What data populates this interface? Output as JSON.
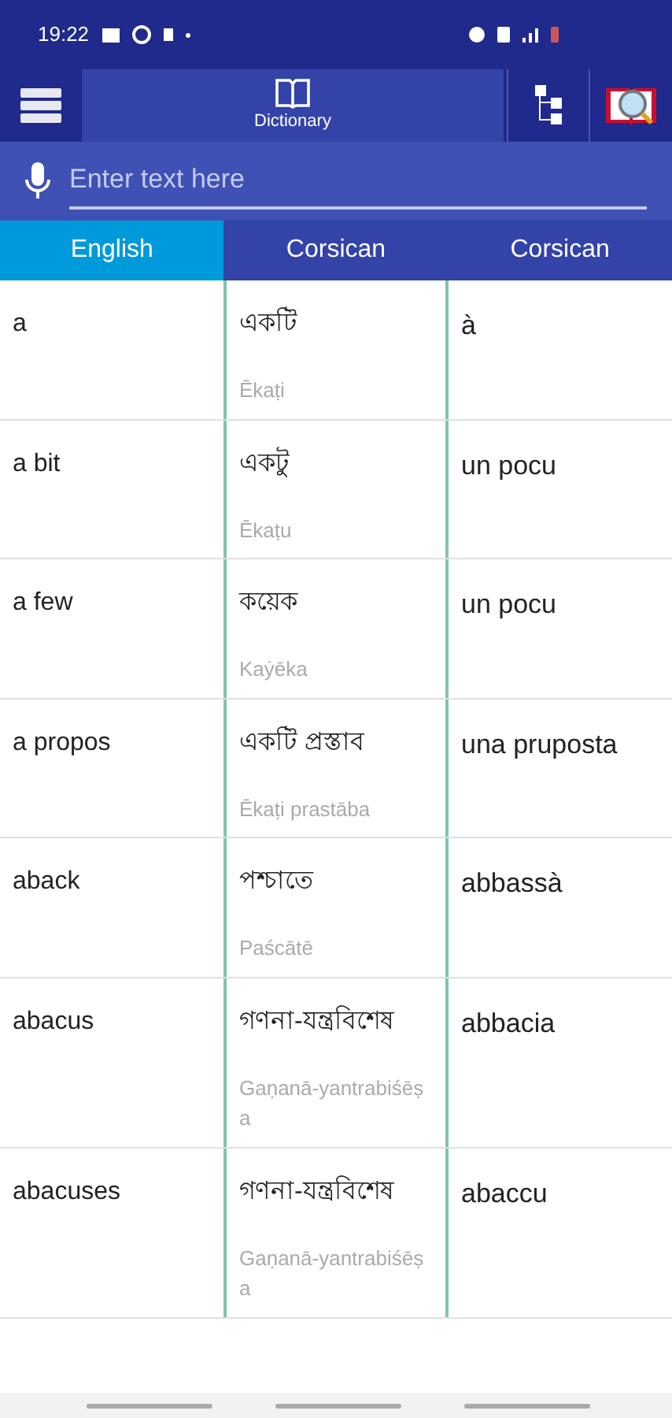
{
  "status_bar": {
    "time": "19:22"
  },
  "toolbar": {
    "title": "Dictionary"
  },
  "search": {
    "placeholder": "Enter text here"
  },
  "tabs": [
    {
      "label": "English",
      "selected": true
    },
    {
      "label": "Corsican",
      "selected": false
    },
    {
      "label": "Corsican",
      "selected": false
    }
  ],
  "rows": [
    {
      "english": "a",
      "bengali": "একটি",
      "transliteration": "Ēkaṭi",
      "corsican": "à"
    },
    {
      "english": "a bit",
      "bengali": "একটু",
      "transliteration": "Ēkaṭu",
      "corsican": "un pocu"
    },
    {
      "english": "a few",
      "bengali": "কয়েক",
      "transliteration": "Kaẏēka",
      "corsican": "un pocu"
    },
    {
      "english": "a propos",
      "bengali": "একটি প্রস্তাব",
      "transliteration": "Ēkaṭi prastāba",
      "corsican": "una pruposta"
    },
    {
      "english": "aback",
      "bengali": "পশ্চাতে",
      "transliteration": "Paścātē",
      "corsican": "abbassà"
    },
    {
      "english": "abacus",
      "bengali": "গণনা-যন্ত্রবিশেষ",
      "transliteration": "Gaṇanā-yantrabiśēṣa",
      "corsican": "abbacia"
    },
    {
      "english": "abacuses",
      "bengali": "গণনা-যন্ত্রবিশেষ",
      "transliteration": "Gaṇanā-yantrabiśēṣa",
      "corsican": "abaccu"
    }
  ]
}
